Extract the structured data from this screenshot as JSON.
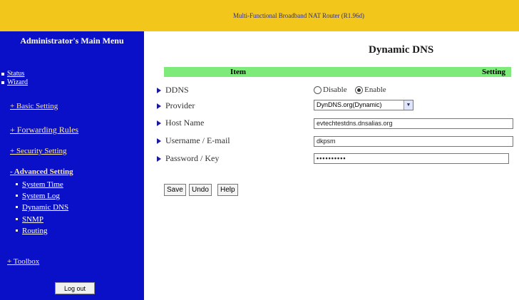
{
  "banner": {
    "title": "Multi-Functional Broadband NAT Router (R1.96d)"
  },
  "sidebar": {
    "title": "Administrator's Main Menu",
    "top_links": [
      "Status",
      "Wizard"
    ],
    "sections": {
      "basic": "+ Basic Setting",
      "forwarding": "+ Forwarding Rules",
      "security": "+ Security Setting",
      "advanced": "- Advanced Setting",
      "toolbox": "+ Toolbox"
    },
    "advanced_items": [
      "System Time",
      "System Log",
      "Dynamic DNS",
      "SNMP",
      "Routing"
    ],
    "logout_label": "Log out"
  },
  "main": {
    "title": "Dynamic DNS",
    "table": {
      "col_item": "Item",
      "col_setting": "Setting"
    },
    "rows": {
      "ddns": {
        "label": "DDNS",
        "disable": "Disable",
        "enable": "Enable",
        "selected": "Enable"
      },
      "provider": {
        "label": "Provider",
        "value": "DynDNS.org(Dynamic)"
      },
      "host": {
        "label": "Host Name",
        "value": "evtechtestdns.dnsalias.org"
      },
      "username": {
        "label": "Username / E-mail",
        "value": "dkpsm"
      },
      "password": {
        "label": "Password / Key",
        "value": "••••••••••"
      }
    },
    "buttons": {
      "save": "Save",
      "undo": "Undo",
      "help": "Help"
    }
  },
  "colors": {
    "banner": "#f2c61a",
    "sidebar": "#0a10c8",
    "table_header": "#7eea7a"
  }
}
